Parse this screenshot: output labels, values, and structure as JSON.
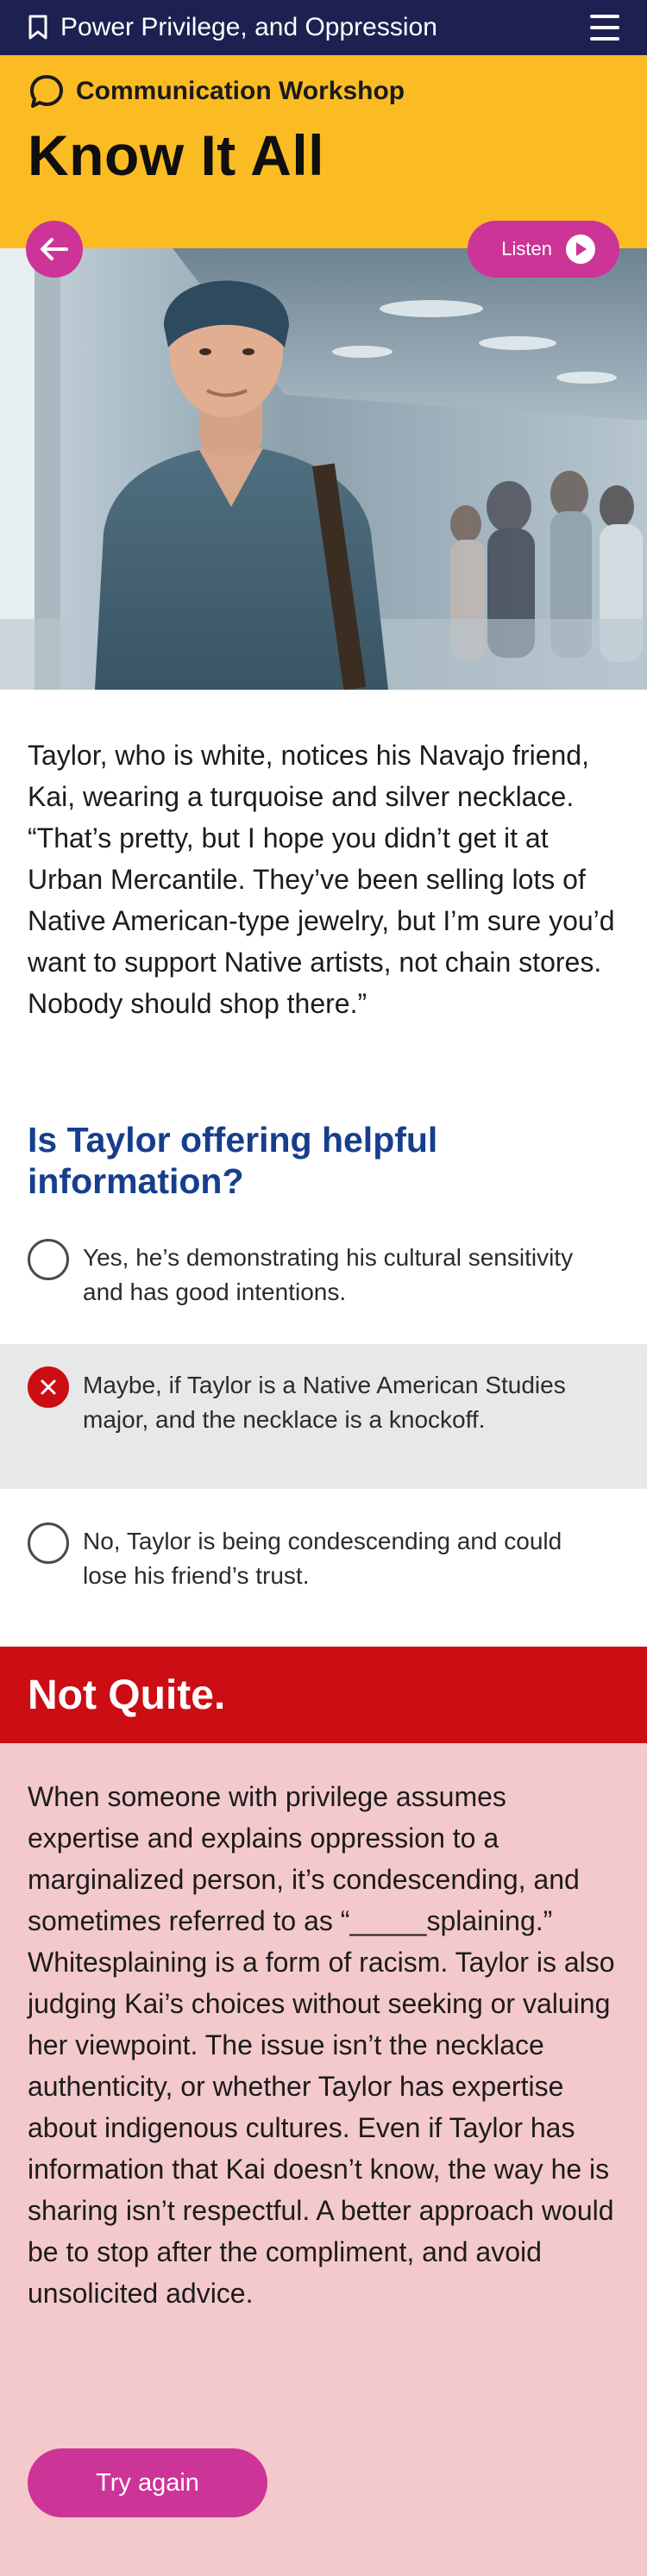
{
  "topbar": {
    "title": "Power Privilege, and Oppression"
  },
  "header": {
    "section": "Communication Workshop",
    "heading": "Know It All"
  },
  "controls": {
    "listen_label": "Listen"
  },
  "story": {
    "text": "Taylor, who is white, notices his Navajo friend, Kai, wearing a turquoise and silver necklace. “That’s pretty, but I hope you didn’t get it at Urban Mercantile. They’ve been selling lots of Native American-type jewelry, but I’m sure you’d want to support Native artists, not chain stores. Nobody should shop there.”"
  },
  "quiz": {
    "question": "Is Taylor offering helpful information?",
    "options": [
      {
        "text": "Yes, he’s demonstrating his cultural sensitivity and has good intentions.",
        "state": "unselected"
      },
      {
        "text": "Maybe, if Taylor is a Native American Studies major, and the necklace is a knockoff.",
        "state": "selected-wrong"
      },
      {
        "text": "No, Taylor is being condescending and could lose his friend’s trust.",
        "state": "unselected"
      }
    ]
  },
  "feedback": {
    "title": "Not Quite.",
    "text": "When someone with privilege assumes expertise and explains oppression to a marginalized person, it’s condescending, and sometimes referred to as “_____splaining.” Whitesplaining is a form of racism. Taylor is also judging Kai’s choices without seeking or valuing her viewpoint. The issue isn’t the necklace authenticity, or whether Taylor has expertise about indigenous cultures. Even if Taylor has information that Kai doesn’t know, the way he is sharing isn’t respectful. A better approach would be to stop after the compliment, and avoid unsolicited advice.",
    "button_label": "Try again"
  },
  "colors": {
    "navy": "#1d2151",
    "yellow": "#fbbc23",
    "magenta": "#cc3497",
    "question_blue": "#163e8c",
    "error_red": "#cc0d13",
    "feedback_pink": "#f4c9cc"
  },
  "icons": [
    "bookmark-icon",
    "menu-icon",
    "speech-bubble-icon",
    "arrow-left-icon",
    "play-icon",
    "close-icon"
  ]
}
